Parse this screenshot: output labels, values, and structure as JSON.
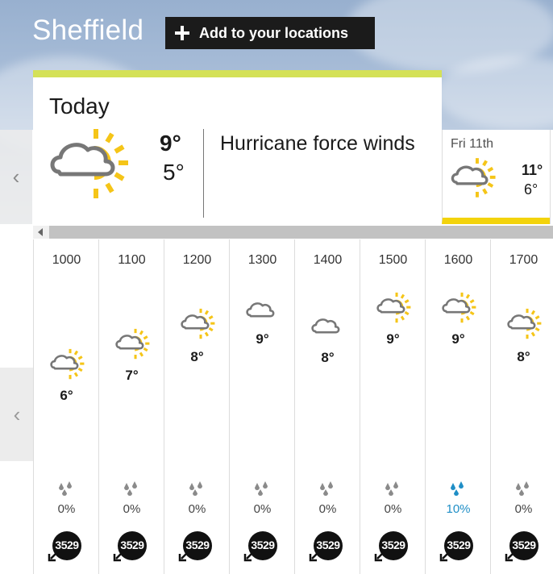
{
  "location": {
    "title": "Sheffield",
    "add_button_label": "Add to your locations"
  },
  "today": {
    "label": "Today",
    "icon": "sunny-intervals-icon",
    "high": "9°",
    "low": "5°",
    "description": "Hurricane force winds"
  },
  "next_day": {
    "label": "Fri 11th",
    "icon": "sunny-intervals-icon",
    "high": "11°",
    "low": "6°"
  },
  "colors": {
    "today_accent": "#d4e157",
    "friday_accent": "#f3d30b",
    "sun": "#f5c518",
    "rain_high": "#1f8ec6"
  },
  "hours": [
    {
      "time": "1000",
      "temp": "6°",
      "icon": "sunny-intervals-icon",
      "rain": "0%",
      "wind": "3529"
    },
    {
      "time": "1100",
      "temp": "7°",
      "icon": "sunny-intervals-icon",
      "rain": "0%",
      "wind": "3529"
    },
    {
      "time": "1200",
      "temp": "8°",
      "icon": "sunny-intervals-icon",
      "rain": "0%",
      "wind": "3529"
    },
    {
      "time": "1300",
      "temp": "9°",
      "icon": "cloud-icon",
      "rain": "0%",
      "wind": "3529"
    },
    {
      "time": "1400",
      "temp": "8°",
      "icon": "cloud-icon",
      "rain": "0%",
      "wind": "3529"
    },
    {
      "time": "1500",
      "temp": "9°",
      "icon": "sunny-intervals-icon",
      "rain": "0%",
      "wind": "3529"
    },
    {
      "time": "1600",
      "temp": "9°",
      "icon": "sunny-intervals-icon",
      "rain": "10%",
      "wind": "3529"
    },
    {
      "time": "1700",
      "temp": "8°",
      "icon": "sunny-intervals-icon",
      "rain": "0%",
      "wind": "3529"
    }
  ]
}
